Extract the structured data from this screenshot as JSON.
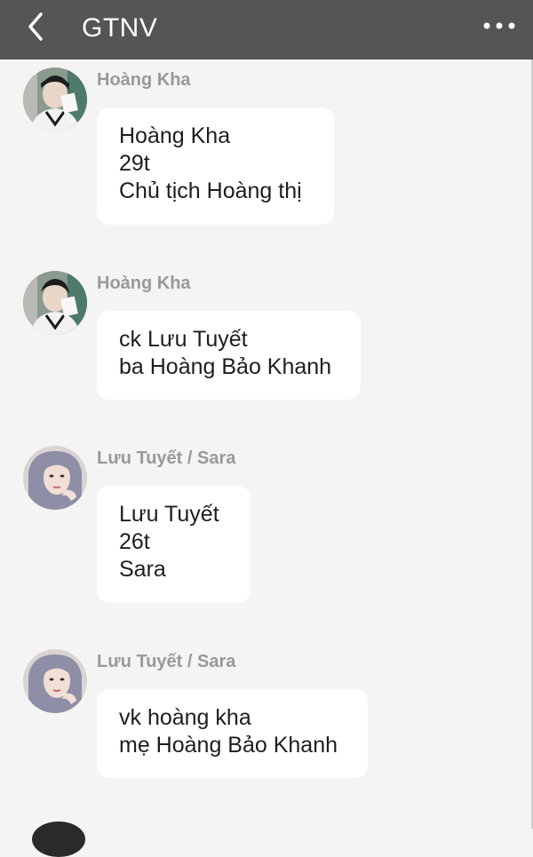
{
  "header": {
    "title": "GTNV",
    "back_icon": "chevron-left-icon",
    "more_icon": "more-horizontal-icon"
  },
  "colors": {
    "header_bg": "#555555",
    "page_bg": "#f4f4f4",
    "bubble_bg": "#ffffff",
    "sender_text": "#999999"
  },
  "messages": [
    {
      "sender": "Hoàng Kha",
      "avatar": "male-avatar",
      "lines": [
        "Hoàng Kha",
        "29t",
        "Chủ tịch Hoàng thị"
      ]
    },
    {
      "sender": "Hoàng Kha",
      "avatar": "male-avatar",
      "lines": [
        "ck Lưu Tuyết",
        "ba Hoàng Bảo Khanh"
      ]
    },
    {
      "sender": "Lưu Tuyết / Sara",
      "avatar": "female-avatar",
      "lines": [
        "Lưu Tuyết",
        "26t",
        "Sara"
      ]
    },
    {
      "sender": "Lưu Tuyết / Sara",
      "avatar": "female-avatar",
      "lines": [
        "vk hoàng kha",
        "mẹ Hoàng Bảo Khanh"
      ]
    }
  ]
}
